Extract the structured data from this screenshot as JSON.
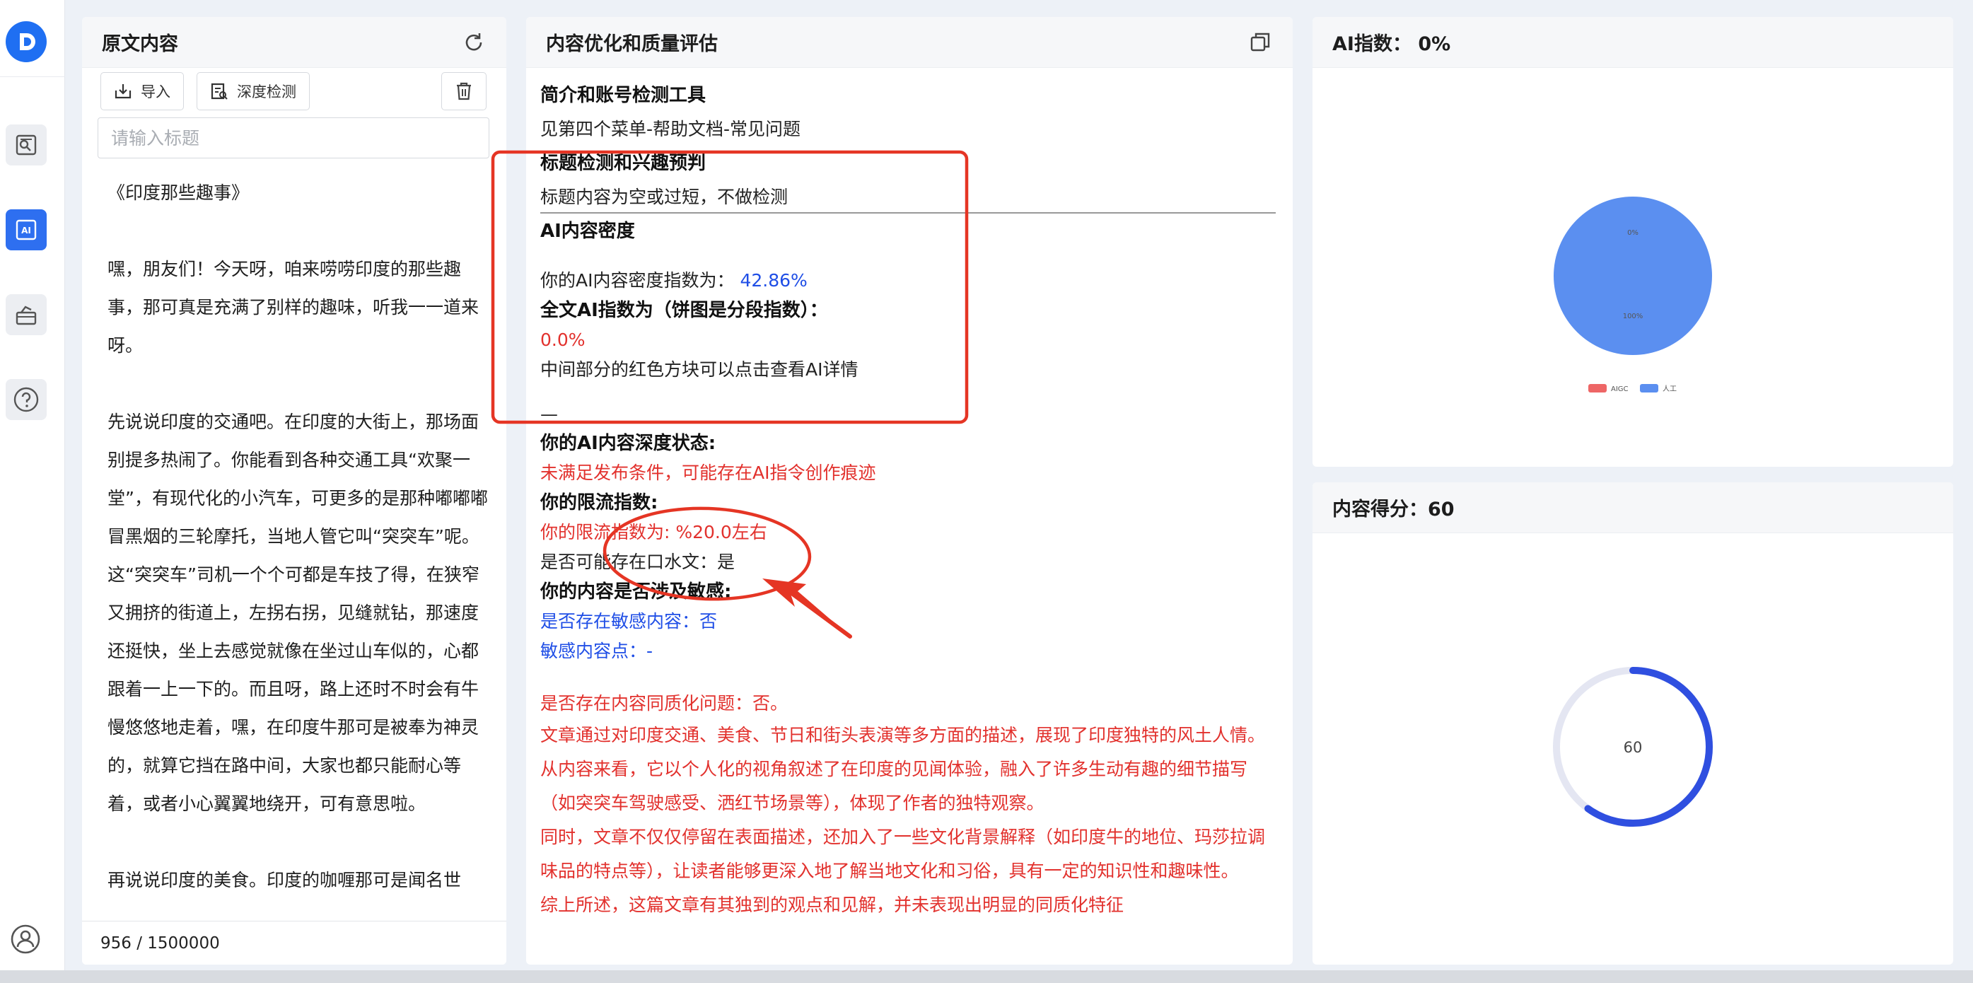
{
  "sidebar": {
    "items": [
      {
        "name": "detect",
        "icon": "document-search-icon"
      },
      {
        "name": "ai",
        "icon": "ai-icon",
        "label": "AI"
      },
      {
        "name": "tools",
        "icon": "toolbox-icon"
      },
      {
        "name": "help",
        "icon": "help-icon"
      }
    ]
  },
  "original": {
    "title": "原文内容",
    "import_label": "导入",
    "deep_detect_label": "深度检测",
    "title_placeholder": "请输入标题",
    "article_title": "《印度那些趣事》",
    "paragraphs": [
      "嘿，朋友们！今天呀，咱来唠唠印度的那些趣事，那可真是充满了别样的趣味，听我一一道来呀。",
      "先说说印度的交通吧。在印度的大街上，那场面别提多热闹了。你能看到各种交通工具“欢聚一堂”，有现代化的小汽车，可更多的是那种嘟嘟嘟冒黑烟的三轮摩托，当地人管它叫“突突车”呢。这“突突车”司机一个个可都是车技了得，在狭窄又拥挤的街道上，左拐右拐，见缝就钻，那速度还挺快，坐上去感觉就像在坐过山车似的，心都跟着一上一下的。而且呀，路上还时不时会有牛慢悠悠地走着，嘿，在印度牛那可是被奉为神灵的，就算它挡在路中间，大家也都只能耐心等着，或者小心翼翼地绕开，可有意思啦。",
      "再说说印度的美食。印度的咖喱那可是闻名世"
    ],
    "counter": "956 / 1500000"
  },
  "eval": {
    "title": "内容优化和质量评估",
    "s1_heading": "简介和账号检测工具",
    "s1_text": "见第四个菜单-帮助文档-常见问题",
    "s2_heading": "标题检测和兴趣预判",
    "s2_text": "标题内容为空或过短，不做检测",
    "s3_heading": "AI内容密度",
    "density_label": "你的AI内容密度指数为：",
    "density_value": "42.86%",
    "fulltext_label": "全文AI指数为（饼图是分段指数）：",
    "fulltext_value": "0.0%",
    "hint": "中间部分的红色方块可以点击查看AI详情",
    "dash": "—",
    "depth_heading": "你的AI内容深度状态:",
    "depth_text": "未满足发布条件，可能存在AI指令创作痕迹",
    "limit_heading": "你的限流指数:",
    "limit_text": "你的限流指数为: %20.0左右",
    "water_text": "是否可能存在口水文：是",
    "sensitive_heading": "你的内容是否涉及敏感:",
    "sensitive_text": "是否存在敏感内容：否",
    "sensitive_points": "敏感内容点：-",
    "homog_text": "是否存在内容同质化问题：否。",
    "analysis_p1": "文章通过对印度交通、美食、节日和街头表演等多方面的描述，展现了印度独特的风土人情。从内容来看，它以个人化的视角叙述了在印度的见闻体验，融入了许多生动有趣的细节描写（如突突车驾驶感受、洒红节场景等），体现了作者的独特观察。",
    "analysis_p2": "同时，文章不仅仅停留在表面描述，还加入了一些文化背景解释（如印度牛的地位、玛莎拉调味品的特点等），让读者能够更深入地了解当地文化和习俗，具有一定的知识性和趣味性。",
    "analysis_p3": "综上所述，这篇文章有其独到的观点和见解，并未表现出明显的同质化特征"
  },
  "ai_panel": {
    "title": "AI指数：  0%",
    "slice_label_aigc": "0%",
    "slice_label_human": "100%",
    "legend": [
      "AIGC",
      "人工"
    ]
  },
  "score_panel": {
    "title": "内容得分：60",
    "score": "60"
  },
  "chart_data": [
    {
      "type": "pie",
      "categories": [
        "AIGC",
        "人工"
      ],
      "values": [
        0,
        100
      ],
      "colors": [
        "#ee6666",
        "#5b8ff0"
      ],
      "legend": "bottom"
    },
    {
      "type": "gauge",
      "values": [
        60
      ],
      "range": [
        0,
        100
      ],
      "colors": [
        "#2f4fe0",
        "#e4e6f2"
      ]
    }
  ],
  "colors": {
    "accent": "#2e6ff0",
    "warning": "#e2312d",
    "info": "#1f4ee6",
    "annotation": "#e53524"
  }
}
